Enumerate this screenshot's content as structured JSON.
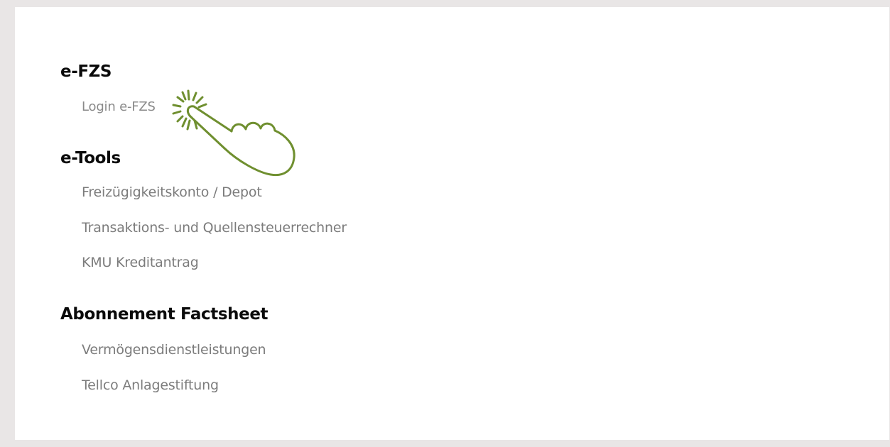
{
  "sections": [
    {
      "title": "e-FZS",
      "links": [
        "Login e-FZS"
      ]
    },
    {
      "title": "e-Tools",
      "links": [
        "Freizügigkeitskonto / Depot",
        "Transaktions- und Quellensteuerrechner",
        "KMU Kreditantrag"
      ]
    },
    {
      "title": "Abonnement Factsheet",
      "links": [
        "Vermögensdienstleistungen",
        "Tellco Anlagestiftung"
      ]
    }
  ],
  "icons": {
    "pointer": "tap-hand-icon"
  },
  "colors": {
    "accent": "#6f8f2f",
    "link": "#7c7c7c",
    "heading": "#0a0a0a",
    "background": "#e9e6e6"
  }
}
